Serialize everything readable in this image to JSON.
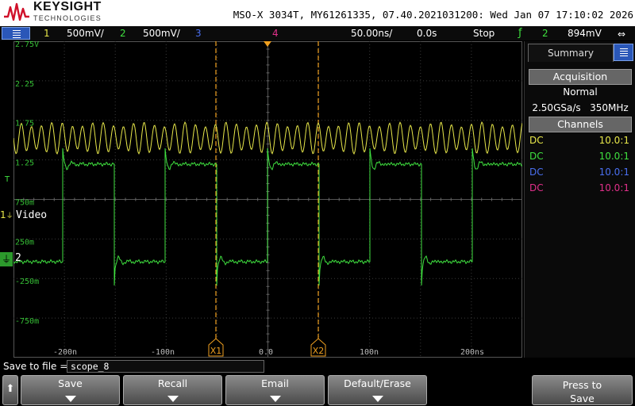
{
  "header": {
    "brand": "KEYSIGHT",
    "brand_sub": "TECHNOLOGIES",
    "model_line": "MSO-X 3034T, MY61261335, 07.40.2021031200: Wed Jan 07 17:10:02 2026"
  },
  "status": {
    "ch1_num": "1",
    "ch1_scale": "500mV/",
    "ch2_num": "2",
    "ch2_scale": "500mV/",
    "ch3_num": "3",
    "ch4_num": "4",
    "timebase": "50.00ns/",
    "delay": "0.0s",
    "run_state": "Stop",
    "trigger_src": "2",
    "trigger_level": "894mV"
  },
  "grid": {
    "y_labels": [
      "2.75V",
      "2.25",
      "1.75",
      "1.25",
      "750m",
      "250m",
      "-250m",
      "-750m"
    ],
    "x_labels": [
      "-200n",
      "-100n",
      "0.0",
      "100n",
      "200ns"
    ],
    "ch1_label": "Video",
    "ch2_label": "2",
    "ch1_marker": "1",
    "trigger_marker": "T",
    "cursor_x1": "X1",
    "cursor_x2": "X2"
  },
  "panel": {
    "tab_summary": "Summary",
    "acquisition_head": "Acquisition",
    "acq_mode": "Normal",
    "acq_rate": "2.50GSa/s   350MHz",
    "channels_head": "Channels",
    "channels": [
      {
        "coupling": "DC",
        "probe": "10.0:1",
        "color": "#e8e84a"
      },
      {
        "coupling": "DC",
        "probe": "10.0:1",
        "color": "#3fe03f"
      },
      {
        "coupling": "DC",
        "probe": "10.0:1",
        "color": "#4a6ff0"
      },
      {
        "coupling": "DC",
        "probe": "10.0:1",
        "color": "#e0308a"
      }
    ]
  },
  "save": {
    "label": "Save to file =",
    "filename": "scope_8"
  },
  "softkeys": {
    "up": "⬆",
    "save": "Save",
    "recall": "Recall",
    "email": "Email",
    "default_erase": "Default/Erase",
    "press_to_save": "Press to\nSave"
  },
  "colors": {
    "ch1": "#e8e84a",
    "ch2": "#3fe03f",
    "ch3": "#4a6ff0",
    "ch4": "#e0308a",
    "cursor": "#f0a020",
    "grid": "#3a3a3a"
  }
}
